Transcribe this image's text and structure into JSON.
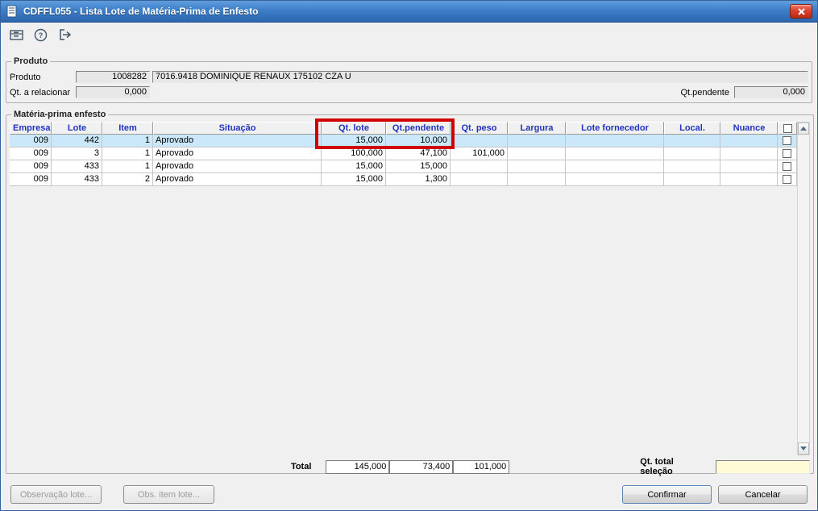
{
  "colors": {
    "titlebar_blue": "#3d7ec9",
    "selected_row": "#cbe8fa",
    "header_text_blue": "#2133bd",
    "annotation_red": "#d10000",
    "selection_field_bg": "#fffbd6"
  },
  "window": {
    "title": "CDFFL055 - Lista Lote de Matéria-Prima de Enfesto"
  },
  "toolbar": {
    "icons": [
      "card-file-icon",
      "help-icon",
      "exit-icon"
    ]
  },
  "produto": {
    "group_label": "Produto",
    "produto_label": "Produto",
    "produto_code": "1008282",
    "produto_desc": "7016.9418 DOMINIQUE RENAUX 175102 CZA U",
    "qt_relacionar_label": "Qt. a relacionar",
    "qt_relacionar_value": "0,000",
    "qt_pendente_label": "Qt.pendente",
    "qt_pendente_value": "0,000"
  },
  "grid": {
    "group_label": "Matéria-prima enfesto",
    "headers": {
      "empresa": "Empresa",
      "lote": "Lote",
      "item": "Item",
      "situacao": "Situação",
      "qt_lote": "Qt. lote",
      "qt_pendente": "Qt.pendente",
      "qt_peso": "Qt. peso",
      "largura": "Largura",
      "lote_fornecedor": "Lote fornecedor",
      "local": "Local.",
      "nuance": "Nuance"
    },
    "rows": [
      {
        "empresa": "009",
        "lote": "442",
        "item": "1",
        "situacao": "Aprovado",
        "qt_lote": "15,000",
        "qt_pendente": "10,000",
        "qt_peso": "",
        "largura": "",
        "lote_fornecedor": "",
        "local": "",
        "nuance": ""
      },
      {
        "empresa": "009",
        "lote": "3",
        "item": "1",
        "situacao": "Aprovado",
        "qt_lote": "100,000",
        "qt_pendente": "47,100",
        "qt_peso": "101,000",
        "largura": "",
        "lote_fornecedor": "",
        "local": "",
        "nuance": ""
      },
      {
        "empresa": "009",
        "lote": "433",
        "item": "1",
        "situacao": "Aprovado",
        "qt_lote": "15,000",
        "qt_pendente": "15,000",
        "qt_peso": "",
        "largura": "",
        "lote_fornecedor": "",
        "local": "",
        "nuance": ""
      },
      {
        "empresa": "009",
        "lote": "433",
        "item": "2",
        "situacao": "Aprovado",
        "qt_lote": "15,000",
        "qt_pendente": "1,300",
        "qt_peso": "",
        "largura": "",
        "lote_fornecedor": "",
        "local": "",
        "nuance": ""
      }
    ]
  },
  "totals": {
    "label": "Total",
    "qt_lote": "145,000",
    "qt_pendente": "73,400",
    "qt_peso": "101,000",
    "selecao_label": "Qt. total seleção",
    "selecao_value": ""
  },
  "footer": {
    "obs_lote": "Observação lote...",
    "obs_item": "Obs. item lote...",
    "confirmar": "Confirmar",
    "cancelar": "Cancelar"
  }
}
